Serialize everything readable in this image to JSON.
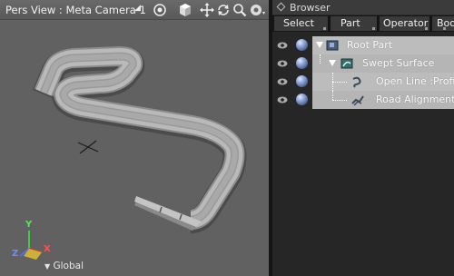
{
  "viewport": {
    "title": "Pers View : Meta Camera 1",
    "axis_label": "Global",
    "axis_letters": {
      "y": "Y",
      "z": "Z",
      "x": "X"
    }
  },
  "browser": {
    "title": "Browser",
    "menus": [
      {
        "label": "Select"
      },
      {
        "label": "Part"
      },
      {
        "label": "Operator"
      },
      {
        "label": "Boo"
      }
    ],
    "tree": [
      {
        "label": "Root Part",
        "icon": "part-icon"
      },
      {
        "label": "Swept Surface",
        "icon": "surface-icon"
      },
      {
        "label": "Open Line :Profil",
        "icon": "curve-icon"
      },
      {
        "label": "Road Alignment",
        "icon": "alignment-icon"
      }
    ]
  },
  "colors": {
    "viewport_bg": "#616161",
    "panel_bg": "#262626",
    "tree_selected": "#bcbcbc"
  }
}
